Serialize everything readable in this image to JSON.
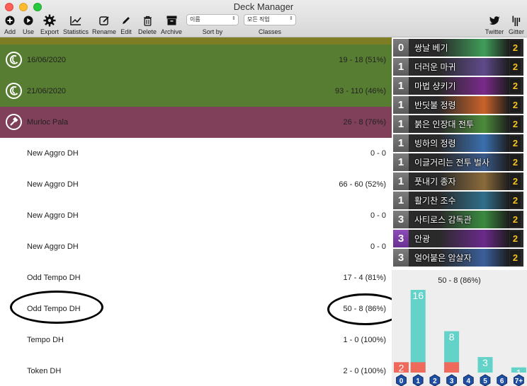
{
  "window": {
    "title": "Deck Manager"
  },
  "toolbar": {
    "add": "Add",
    "use": "Use",
    "export": "Export",
    "statistics": "Statistics",
    "rename": "Rename",
    "edit": "Edit",
    "delete": "Delete",
    "archive": "Archive",
    "sort_value": "이름",
    "sort_label": "Sort by",
    "class_value": "모든 직업",
    "class_label": "Classes",
    "twitter": "Twitter",
    "gitter": "Gitter"
  },
  "decks": [
    {
      "name": "16/06/2020",
      "record": "19 - 18 (51%)",
      "style": "green",
      "class_icon": "druid-icon"
    },
    {
      "name": "21/06/2020",
      "record": "93 - 110 (46%)",
      "style": "green",
      "class_icon": "druid-icon"
    },
    {
      "name": "Murloc Pala",
      "record": "26 - 8 (76%)",
      "style": "maroon",
      "class_icon": "hammer-icon"
    },
    {
      "name": "New Aggro DH",
      "record": "0 - 0",
      "style": "plain"
    },
    {
      "name": "New Aggro DH",
      "record": "66 - 60 (52%)",
      "style": "plain"
    },
    {
      "name": "New Aggro DH",
      "record": "0 - 0",
      "style": "plain"
    },
    {
      "name": "New Aggro DH",
      "record": "0 - 0",
      "style": "plain"
    },
    {
      "name": "Odd Tempo DH",
      "record": "17 - 4 (81%)",
      "style": "plain"
    },
    {
      "name": "Odd Tempo DH",
      "record": "50 - 8 (86%)",
      "style": "plain",
      "highlighted": true
    },
    {
      "name": "Tempo DH",
      "record": "1 - 0 (100%)",
      "style": "plain"
    },
    {
      "name": "Token DH",
      "record": "2 - 0 (100%)",
      "style": "plain"
    }
  ],
  "cards": [
    {
      "cost": "0",
      "name": "쌍날 베기",
      "count": "2",
      "rarity": "common",
      "art": "#3f9e5a"
    },
    {
      "cost": "1",
      "name": "더러운 마귀",
      "count": "2",
      "rarity": "common",
      "art": "#5f4a8a"
    },
    {
      "cost": "1",
      "name": "마법 샹키기",
      "count": "2",
      "rarity": "common",
      "art": "#7a2a8a"
    },
    {
      "cost": "1",
      "name": "반딧불 정령",
      "count": "2",
      "rarity": "common",
      "art": "#c9622a"
    },
    {
      "cost": "1",
      "name": "붉은 인장대 전투",
      "count": "2",
      "rarity": "common",
      "art": "#4c8a3a"
    },
    {
      "cost": "1",
      "name": "빙하의 정령",
      "count": "2",
      "rarity": "common",
      "art": "#3a6fae"
    },
    {
      "cost": "1",
      "name": "이글거리는 전투 벌사",
      "count": "2",
      "rarity": "common",
      "art": "#3a5a8a"
    },
    {
      "cost": "1",
      "name": "풋내기 종자",
      "count": "2",
      "rarity": "common",
      "art": "#8a6a3a"
    },
    {
      "cost": "1",
      "name": "활기찬 조수",
      "count": "2",
      "rarity": "common",
      "art": "#2f6f8a"
    },
    {
      "cost": "3",
      "name": "사티로스 감독관",
      "count": "2",
      "rarity": "common",
      "art": "#3a8a3f"
    },
    {
      "cost": "3",
      "name": "안광",
      "count": "2",
      "rarity": "epic",
      "art": "#6a2a8a"
    },
    {
      "cost": "3",
      "name": "얼어붙은 암살자",
      "count": "2",
      "rarity": "common",
      "art": "#3a5f9a"
    }
  ],
  "chart_data": {
    "type": "bar",
    "title": "50 - 8 (86%)",
    "categories": [
      "0",
      "1",
      "2",
      "3",
      "4",
      "5",
      "6",
      "7+"
    ],
    "series": [
      {
        "values": [
          2,
          16,
          0,
          8,
          0,
          3,
          0,
          1
        ],
        "color": "#63d2c8"
      },
      {
        "values": [
          2,
          2,
          0,
          2,
          0,
          0,
          0,
          0
        ],
        "color": "#ef6a5b"
      }
    ],
    "ylim": [
      0,
      16
    ]
  }
}
